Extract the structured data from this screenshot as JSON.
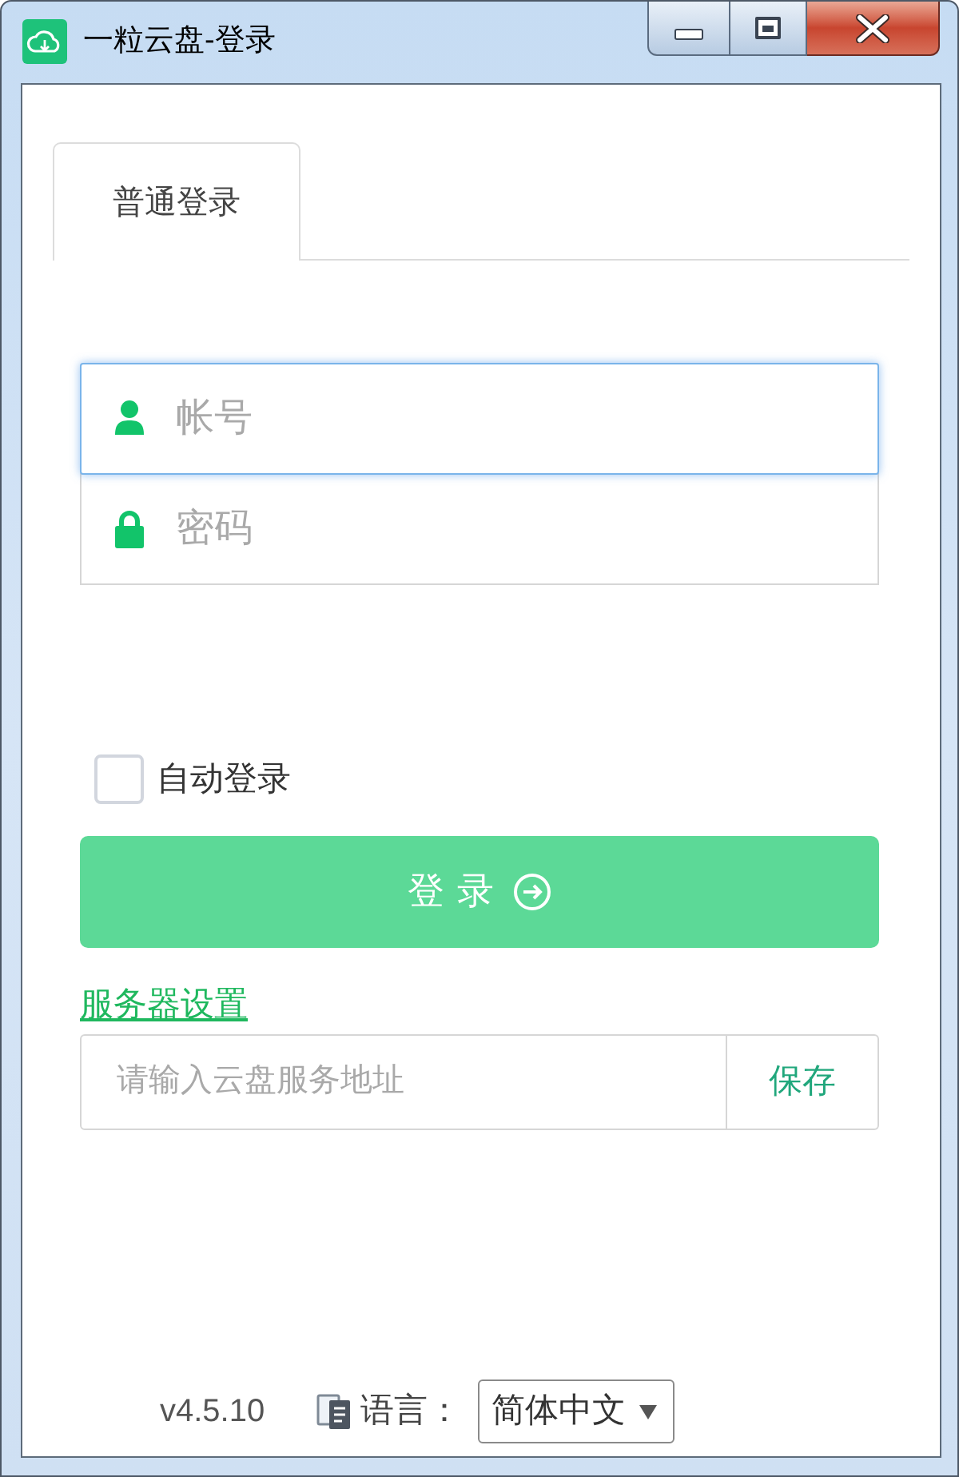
{
  "window": {
    "title": "一粒云盘-登录"
  },
  "tabs": [
    {
      "label": "普通登录",
      "selected": true
    }
  ],
  "fields": [
    {
      "kind": "account",
      "placeholder": "帐号",
      "focused": true
    },
    {
      "kind": "password",
      "placeholder": "密码",
      "focused": false
    }
  ],
  "auto_login": {
    "label": "自动登录",
    "checked": false
  },
  "login_button": {
    "label": "登录"
  },
  "server_settings": {
    "link": "服务器设置",
    "placeholder": "请输入云盘服务地址",
    "save_button": "保存"
  },
  "footer": {
    "version": "v4.5.10",
    "language_label": "语言：",
    "language_value": "简体中文"
  }
}
